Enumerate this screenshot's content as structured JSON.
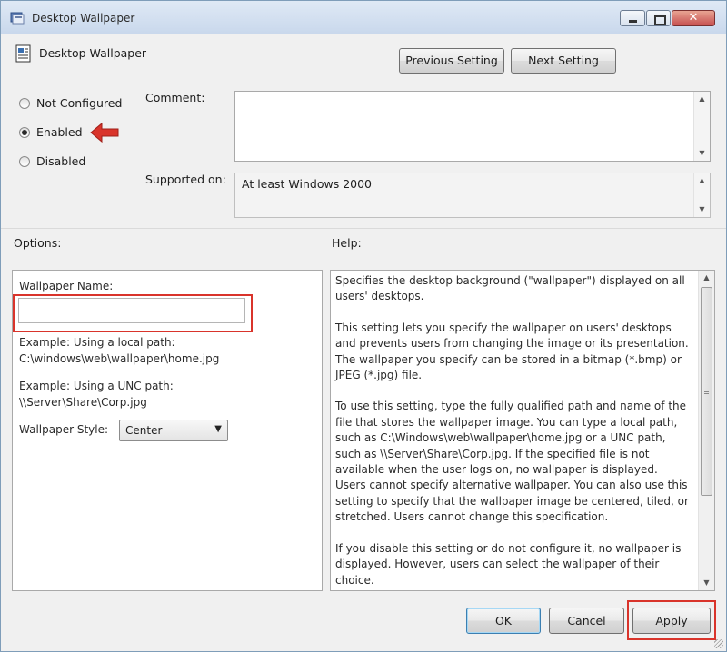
{
  "window": {
    "title": "Desktop Wallpaper",
    "close_glyph": "✕"
  },
  "header": {
    "policy_name": "Desktop Wallpaper",
    "prev_label": "Previous Setting",
    "next_label": "Next Setting"
  },
  "state": {
    "options": [
      {
        "label": "Not Configured",
        "selected": false
      },
      {
        "label": "Enabled",
        "selected": true
      },
      {
        "label": "Disabled",
        "selected": false
      }
    ]
  },
  "comment": {
    "label": "Comment:",
    "value": ""
  },
  "supported": {
    "label": "Supported on:",
    "value": "At least Windows 2000"
  },
  "options_panel": {
    "heading": "Options:",
    "name_label": "Wallpaper Name:",
    "name_value": "",
    "example_local_title": "Example: Using a local path:",
    "example_local_path": "C:\\windows\\web\\wallpaper\\home.jpg",
    "example_unc_title": "Example: Using a UNC path:",
    "example_unc_path": "\\\\Server\\Share\\Corp.jpg",
    "style_label": "Wallpaper Style:",
    "style_value": "Center"
  },
  "help_panel": {
    "heading": "Help:",
    "paragraphs": [
      "Specifies the desktop background (\"wallpaper\") displayed on all users' desktops.",
      "This setting lets you specify the wallpaper on users' desktops and prevents users from changing the image or its presentation. The wallpaper you specify can be stored in a bitmap (*.bmp) or JPEG (*.jpg) file.",
      "To use this setting, type the fully qualified path and name of the file that stores the wallpaper image. You can type a local path, such as C:\\Windows\\web\\wallpaper\\home.jpg or a UNC path, such as \\\\Server\\Share\\Corp.jpg. If the specified file is not available when the user logs on, no wallpaper is displayed. Users cannot specify alternative wallpaper. You can also use this setting to specify that the wallpaper image be centered, tiled, or stretched. Users cannot change this specification.",
      "If you disable this setting or do not configure it, no wallpaper is displayed. However, users can select the wallpaper of their choice."
    ]
  },
  "footer": {
    "ok_label": "OK",
    "cancel_label": "Cancel",
    "apply_label": "Apply"
  },
  "colors": {
    "highlight": "#d9342b",
    "window_bg": "#f0f0f0"
  }
}
